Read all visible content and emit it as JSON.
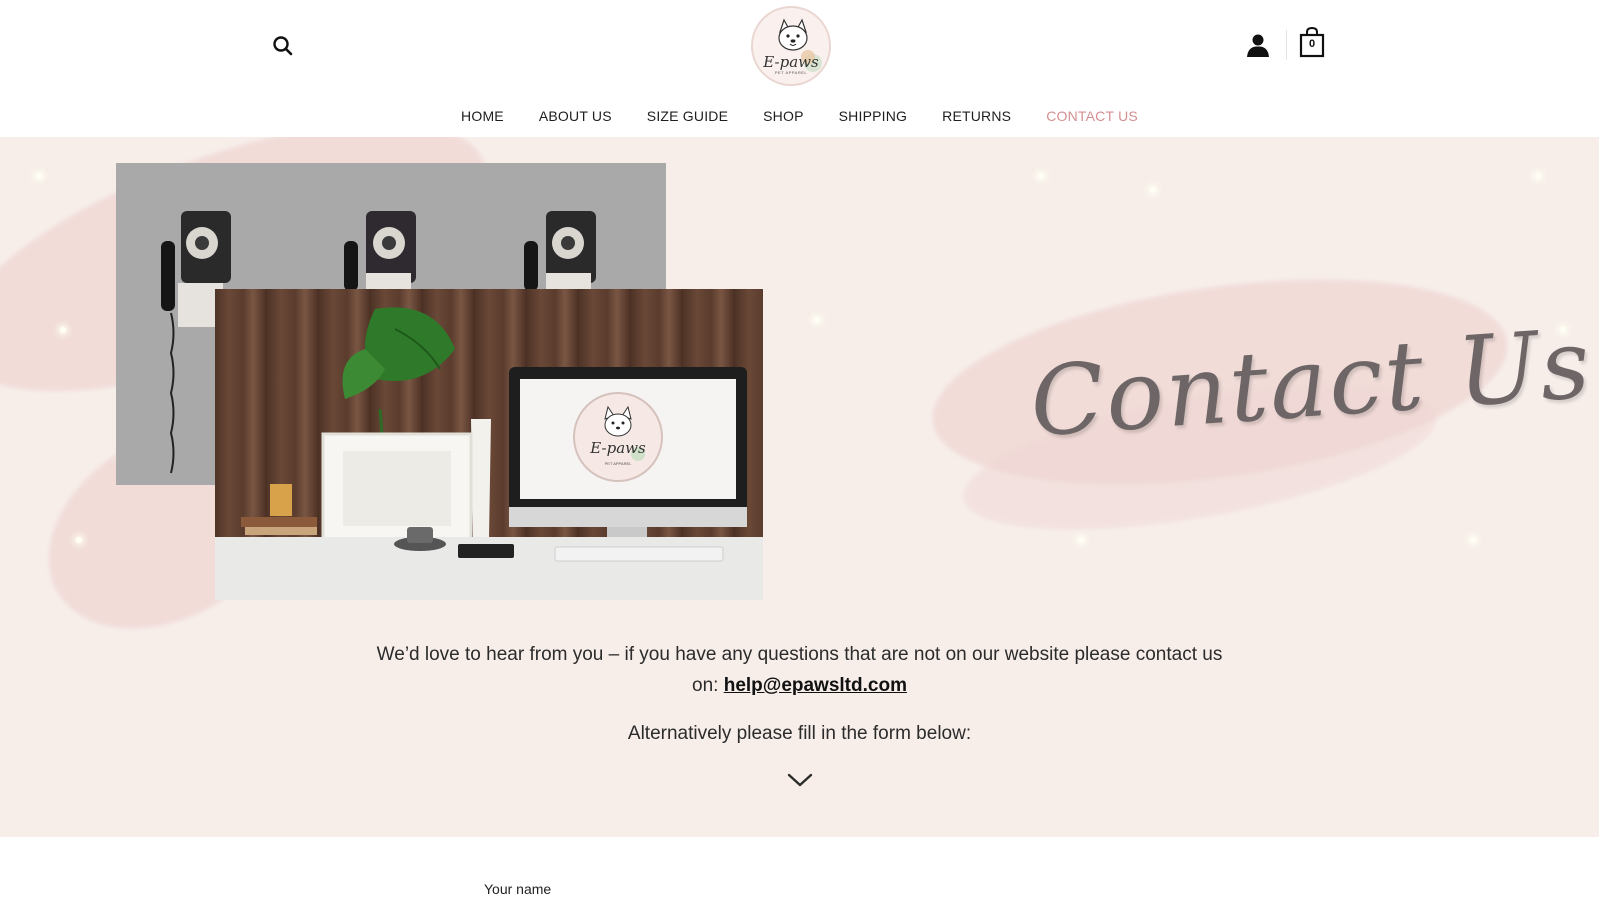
{
  "header": {
    "brand_name": "E-paws",
    "brand_tagline": "PET APPAREL",
    "cart_count": "0",
    "icons": [
      "search-icon",
      "user-icon",
      "shopping-bag-icon"
    ]
  },
  "nav": {
    "items": [
      {
        "label": "HOME"
      },
      {
        "label": "ABOUT US"
      },
      {
        "label": "SIZE GUIDE"
      },
      {
        "label": "SHOP"
      },
      {
        "label": "SHIPPING"
      },
      {
        "label": "RETURNS"
      },
      {
        "label": "CONTACT US",
        "active": true
      }
    ]
  },
  "hero": {
    "heading": "Contact Us",
    "monitor_brand": "E-paws",
    "monitor_tagline": "PET APPAREL"
  },
  "intro": {
    "text_line1": "We’d love to hear from you – if you have any questions that are not on our website please contact us",
    "text_line2_prefix": "on: ",
    "email": "help@epawsltd.com",
    "alternative": "Alternatively please fill in the form below:"
  },
  "form": {
    "name_label": "Your name"
  },
  "colors": {
    "accent": "#d48f92",
    "hero_bg": "#f7eeea",
    "brush": "#efd6d3",
    "text": "#2b2b2b"
  }
}
